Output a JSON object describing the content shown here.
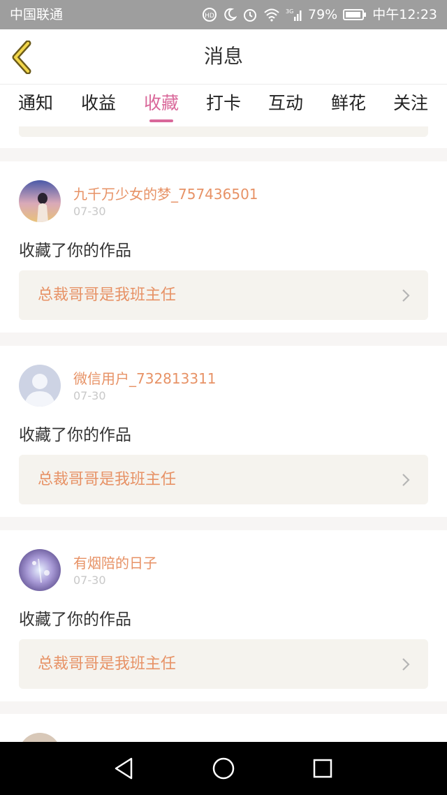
{
  "status_bar": {
    "carrier": "中国联通",
    "battery": "79%",
    "time": "中午12:23",
    "network": "3G"
  },
  "header": {
    "title": "消息",
    "back_icon": "chevron-left-icon"
  },
  "tabs": [
    {
      "label": "通知",
      "active": false
    },
    {
      "label": "收益",
      "active": false
    },
    {
      "label": "收藏",
      "active": true
    },
    {
      "label": "打卡",
      "active": false
    },
    {
      "label": "互动",
      "active": false
    },
    {
      "label": "鲜花",
      "active": false
    },
    {
      "label": "关注",
      "active": false
    }
  ],
  "messages": [
    {
      "user": "九千万少女的梦_757436501",
      "date": "07-30",
      "action": "收藏了你的作品",
      "work": "总裁哥哥是我班主任"
    },
    {
      "user": "微信用户_732813311",
      "date": "07-30",
      "action": "收藏了你的作品",
      "work": "总裁哥哥是我班主任"
    },
    {
      "user": "有烟陪的日子",
      "date": "07-30",
      "action": "收藏了你的作品",
      "work": "总裁哥哥是我班主任"
    }
  ],
  "colors": {
    "accent": "#d9689a",
    "username": "#e79266",
    "work_title": "#e79266",
    "status_bar": "#9e9e9e"
  }
}
